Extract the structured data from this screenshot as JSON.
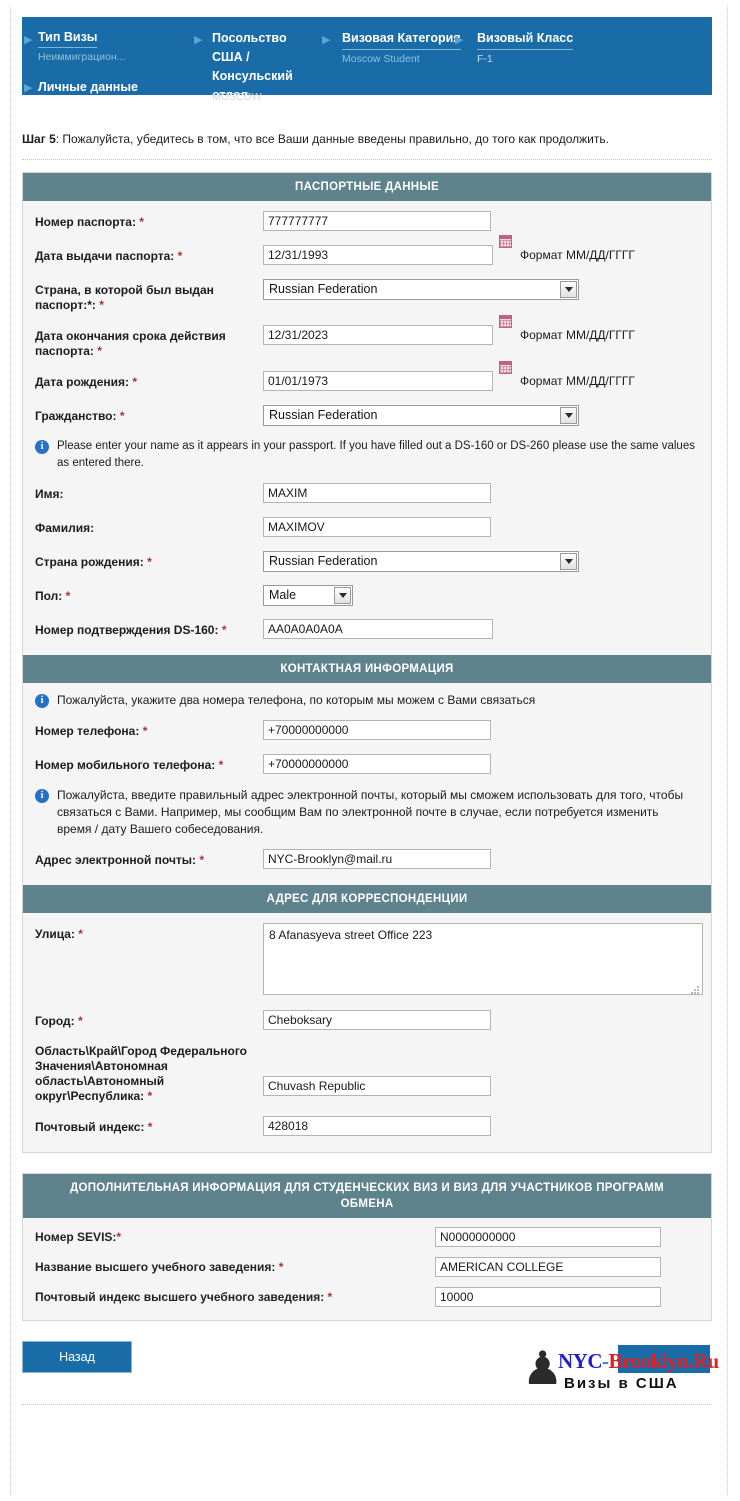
{
  "nav": {
    "items": [
      {
        "title": "Тип Визы",
        "sub": "Неиммиграцион...",
        "title2": "Личные данные"
      },
      {
        "title": "Посольство США / Консульский отдел",
        "sub": "MOSCOW"
      },
      {
        "title": "Визовая Категория",
        "sub": "Moscow Student"
      },
      {
        "title": "Визовый Класс",
        "sub": "F-1"
      }
    ],
    "arrow_glyph": "▶"
  },
  "step": {
    "prefix": "Шаг 5",
    "text": ": Пожалуйста, убедитесь в том, что все Ваши данные введены правильно, до того как продолжить."
  },
  "sections": {
    "passport": {
      "title": "ПАСПОРТНЫЕ ДАННЫЕ",
      "passport_number_label": "Номер паспорта:",
      "passport_number_value": "777777777",
      "issue_date_label": "Дата выдачи паспорта:",
      "issue_date_value": "12/31/1993",
      "issue_date_format": "Формат ММ/ДД/ГГГГ",
      "issuing_country_label": "Страна, в которой был выдан паспорт:*:",
      "issuing_country_value": "Russian Federation",
      "expiry_date_label": "Дата окончания срока действия паспорта:",
      "expiry_date_value": "12/31/2023",
      "expiry_date_format": "Формат ММ/ДД/ГГГГ",
      "birth_date_label": "Дата рождения:",
      "birth_date_value": "01/01/1973",
      "birth_date_format": "Формат ММ/ДД/ГГГГ",
      "citizenship_label": "Гражданство:",
      "citizenship_value": "Russian Federation",
      "name_note": "Please enter your name as it appears in your passport. If you have filled out a DS-160 or DS-260 please use the same values as entered there.",
      "first_name_label": "Имя:",
      "first_name_value": "MAXIM",
      "last_name_label": "Фамилия:",
      "last_name_value": "MAXIMOV",
      "birth_country_label": "Страна рождения:",
      "birth_country_value": "Russian Federation",
      "gender_label": "Пол:",
      "gender_value": "Male",
      "ds160_label": "Номер подтверждения DS-160:",
      "ds160_value": "AA0A0A0A0A"
    },
    "contact": {
      "title": "КОНТАКТНАЯ ИНФОРМАЦИЯ",
      "phone_note": "Пожалуйста, укажите два номера телефона, по которым мы можем с Вами связаться",
      "phone_label": "Номер телефона:",
      "phone_value": "+70000000000",
      "mobile_label": "Номер мобильного телефона:",
      "mobile_value": "+70000000000",
      "email_note": "Пожалуйста, введите правильный адрес электронной почты, который мы сможем использовать для того, чтобы связаться с Вами. Например, мы сообщим Вам по электронной почте в случае, если потребуется изменить время / дату Вашего собеседования.",
      "email_label": "Адрес электронной почты:",
      "email_value": "NYC-Brooklyn@mail.ru"
    },
    "address": {
      "title": "АДРЕС ДЛЯ КОРРЕСПОНДЕНЦИИ",
      "street_label": "Улица:",
      "street_value": "8 Afanasyeva street Office 223",
      "city_label": "Город:",
      "city_value": "Cheboksary",
      "region_label": "Область\\Край\\Город Федерального Значения\\Автономная область\\Автономный округ\\Республика:",
      "region_value": "Chuvash Republic",
      "postal_label": "Почтовый индекс:",
      "postal_value": "428018"
    },
    "student": {
      "title": "ДОПОЛНИТЕЛЬНАЯ ИНФОРМАЦИЯ ДЛЯ СТУДЕНЧЕСКИХ ВИЗ И ВИЗ ДЛЯ УЧАСТНИКОВ ПРОГРАММ ОБМЕНА",
      "sevis_label": "Номер SEVIS:",
      "sevis_value": "N0000000000",
      "school_label": "Название высшего учебного заведения:",
      "school_value": "AMERICAN COLLEGE",
      "school_zip_label": "Почтовый индекс высшего учебного заведения:",
      "school_zip_value": "10000"
    }
  },
  "footer": {
    "back_label": "Назад",
    "logo_nyc": "NYC",
    "logo_dash": "-",
    "logo_brooklyn": "Brooklyn.Ru",
    "logo_tagline": "Визы в США",
    "statue_glyph": "♟"
  },
  "marks": {
    "asterisk": "*"
  },
  "colors": {
    "nav_blue": "#1a6ca8",
    "section_teal": "#5f838d",
    "required_red": "#b03030",
    "info_blue": "#2472c8",
    "logo_blue": "#1f1fd0",
    "logo_red": "#e02020"
  }
}
